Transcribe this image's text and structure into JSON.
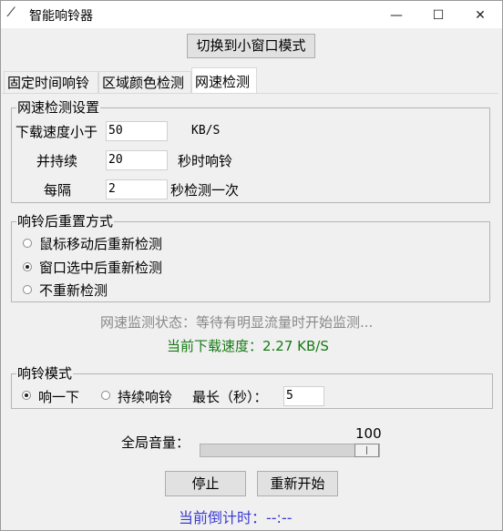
{
  "window": {
    "title": "智能响铃器",
    "minimize": "—",
    "maximize": "☐",
    "close": "✕"
  },
  "toolbar": {
    "switch_label": "切换到小窗口模式"
  },
  "tabs": [
    {
      "label": "固定时间响铃",
      "active": false
    },
    {
      "label": "区域颜色检测",
      "active": false
    },
    {
      "label": "网速检测",
      "active": true
    }
  ],
  "speed_group": {
    "title": "网速检测设置",
    "row1": {
      "label": "下载速度小于",
      "value": "50",
      "unit": "KB/S"
    },
    "row2": {
      "label": "并持续",
      "value": "20",
      "unit": "秒时响铃"
    },
    "row3": {
      "label": "每隔",
      "value": "2",
      "unit": "秒检测一次"
    }
  },
  "reset_group": {
    "title": "响铃后重置方式",
    "options": [
      {
        "label": "鼠标移动后重新检测",
        "selected": false
      },
      {
        "label": "窗口选中后重新检测",
        "selected": true
      },
      {
        "label": "不重新检测",
        "selected": false
      }
    ]
  },
  "status": {
    "monitor": "网速监测状态：等待有明显流量时开始监测...",
    "current_speed": "当前下载速度：2.27 KB/S"
  },
  "ring_mode": {
    "title": "响铃模式",
    "option1": {
      "label": "响一下",
      "selected": true
    },
    "option2": {
      "label": "持续响铃",
      "selected": false
    },
    "max_label": "最长（秒）：",
    "max_value": "5"
  },
  "volume": {
    "label": "全局音量：",
    "value": "100",
    "level": 1.0
  },
  "buttons": {
    "stop": "停止",
    "restart": "重新开始"
  },
  "countdown": "当前倒计时：--:--",
  "colors": {
    "monitor_status": "#888888",
    "speed_status": "#157a15",
    "countdown": "#3b3bd1"
  }
}
